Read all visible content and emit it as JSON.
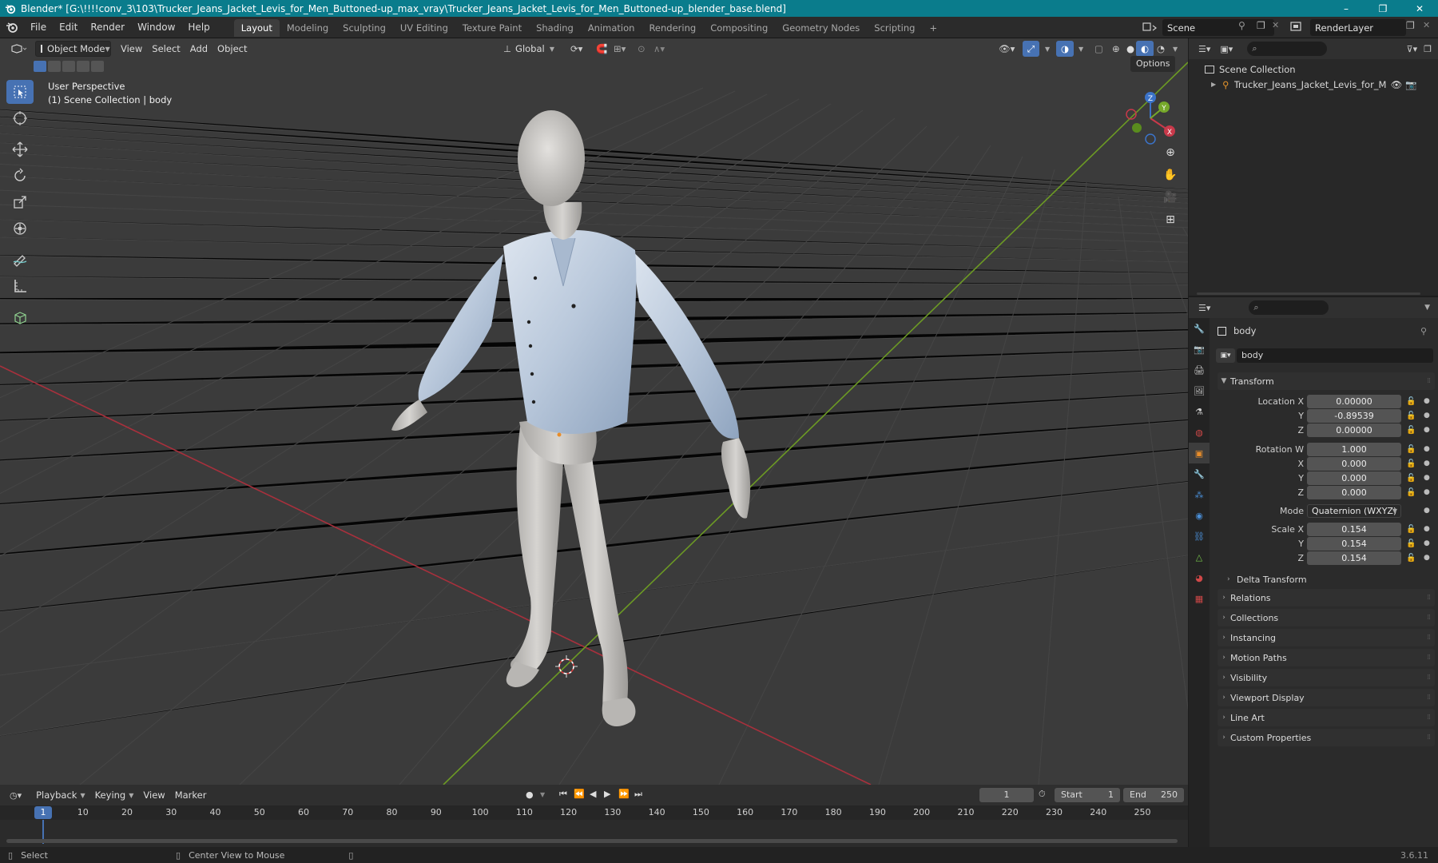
{
  "window": {
    "title": "Blender* [G:\\!!!!conv_3\\103\\Trucker_Jeans_Jacket_Levis_for_Men_Buttoned-up_max_vray\\Trucker_Jeans_Jacket_Levis_for_Men_Buttoned-up_blender_base.blend]",
    "minimize": "–",
    "maximize": "❐",
    "close": "✕"
  },
  "menu": [
    "File",
    "Edit",
    "Render",
    "Window",
    "Help"
  ],
  "workspaces": [
    "Layout",
    "Modeling",
    "Sculpting",
    "UV Editing",
    "Texture Paint",
    "Shading",
    "Animation",
    "Rendering",
    "Compositing",
    "Geometry Nodes",
    "Scripting"
  ],
  "active_workspace": "Layout",
  "add_workspace": "+",
  "scene": "Scene",
  "view_layer": "RenderLayer",
  "viewport": {
    "mode": "Object Mode",
    "menus": [
      "View",
      "Select",
      "Add",
      "Object"
    ],
    "transform_orientation": "Global",
    "options_label": "Options",
    "perspective": "User Perspective",
    "collection_info": "(1) Scene Collection | body",
    "gizmo_axes": [
      "Z",
      "Y",
      "X"
    ]
  },
  "outliner": {
    "root": "Scene Collection",
    "items": [
      {
        "name": "Trucker_Jeans_Jacket_Levis_for_Men_Bu"
      }
    ]
  },
  "properties": {
    "object_name": "body",
    "data_name": "body",
    "transform_panel": "Transform",
    "location": {
      "label": "Location X",
      "x": "0.00000",
      "y": "-0.89539",
      "z": "0.00000"
    },
    "rotation": {
      "label": "Rotation W",
      "w": "1.000",
      "x": "0.000",
      "y": "0.000",
      "z": "0.000"
    },
    "axis_labels": {
      "x": "X",
      "y": "Y",
      "z": "Z"
    },
    "mode_label": "Mode",
    "mode_value": "Quaternion (WXYZ)",
    "scale": {
      "label": "Scale X",
      "x": "0.154",
      "y": "0.154",
      "z": "0.154"
    },
    "delta_transform": "Delta Transform",
    "collapsed_panels": [
      "Relations",
      "Collections",
      "Instancing",
      "Motion Paths",
      "Visibility",
      "Viewport Display",
      "Line Art",
      "Custom Properties"
    ]
  },
  "timeline": {
    "menus": [
      "Playback",
      "Keying",
      "View",
      "Marker"
    ],
    "current_frame": "1",
    "start_label": "Start",
    "start": "1",
    "end_label": "End",
    "end": "250",
    "ticks": [
      "1",
      "10",
      "20",
      "30",
      "40",
      "50",
      "60",
      "70",
      "80",
      "90",
      "100",
      "110",
      "120",
      "130",
      "140",
      "150",
      "160",
      "170",
      "180",
      "190",
      "200",
      "210",
      "220",
      "230",
      "240",
      "250"
    ]
  },
  "status": {
    "left": "Select",
    "middle": "Center View to Mouse",
    "version": "3.6.11"
  },
  "colors": {
    "titlebar": "#0a7c8c",
    "accent": "#4772b3",
    "x_axis": "#c8394a",
    "y_axis": "#76a82a",
    "z_axis": "#3b73c9",
    "object_orange": "#e88d2a"
  }
}
